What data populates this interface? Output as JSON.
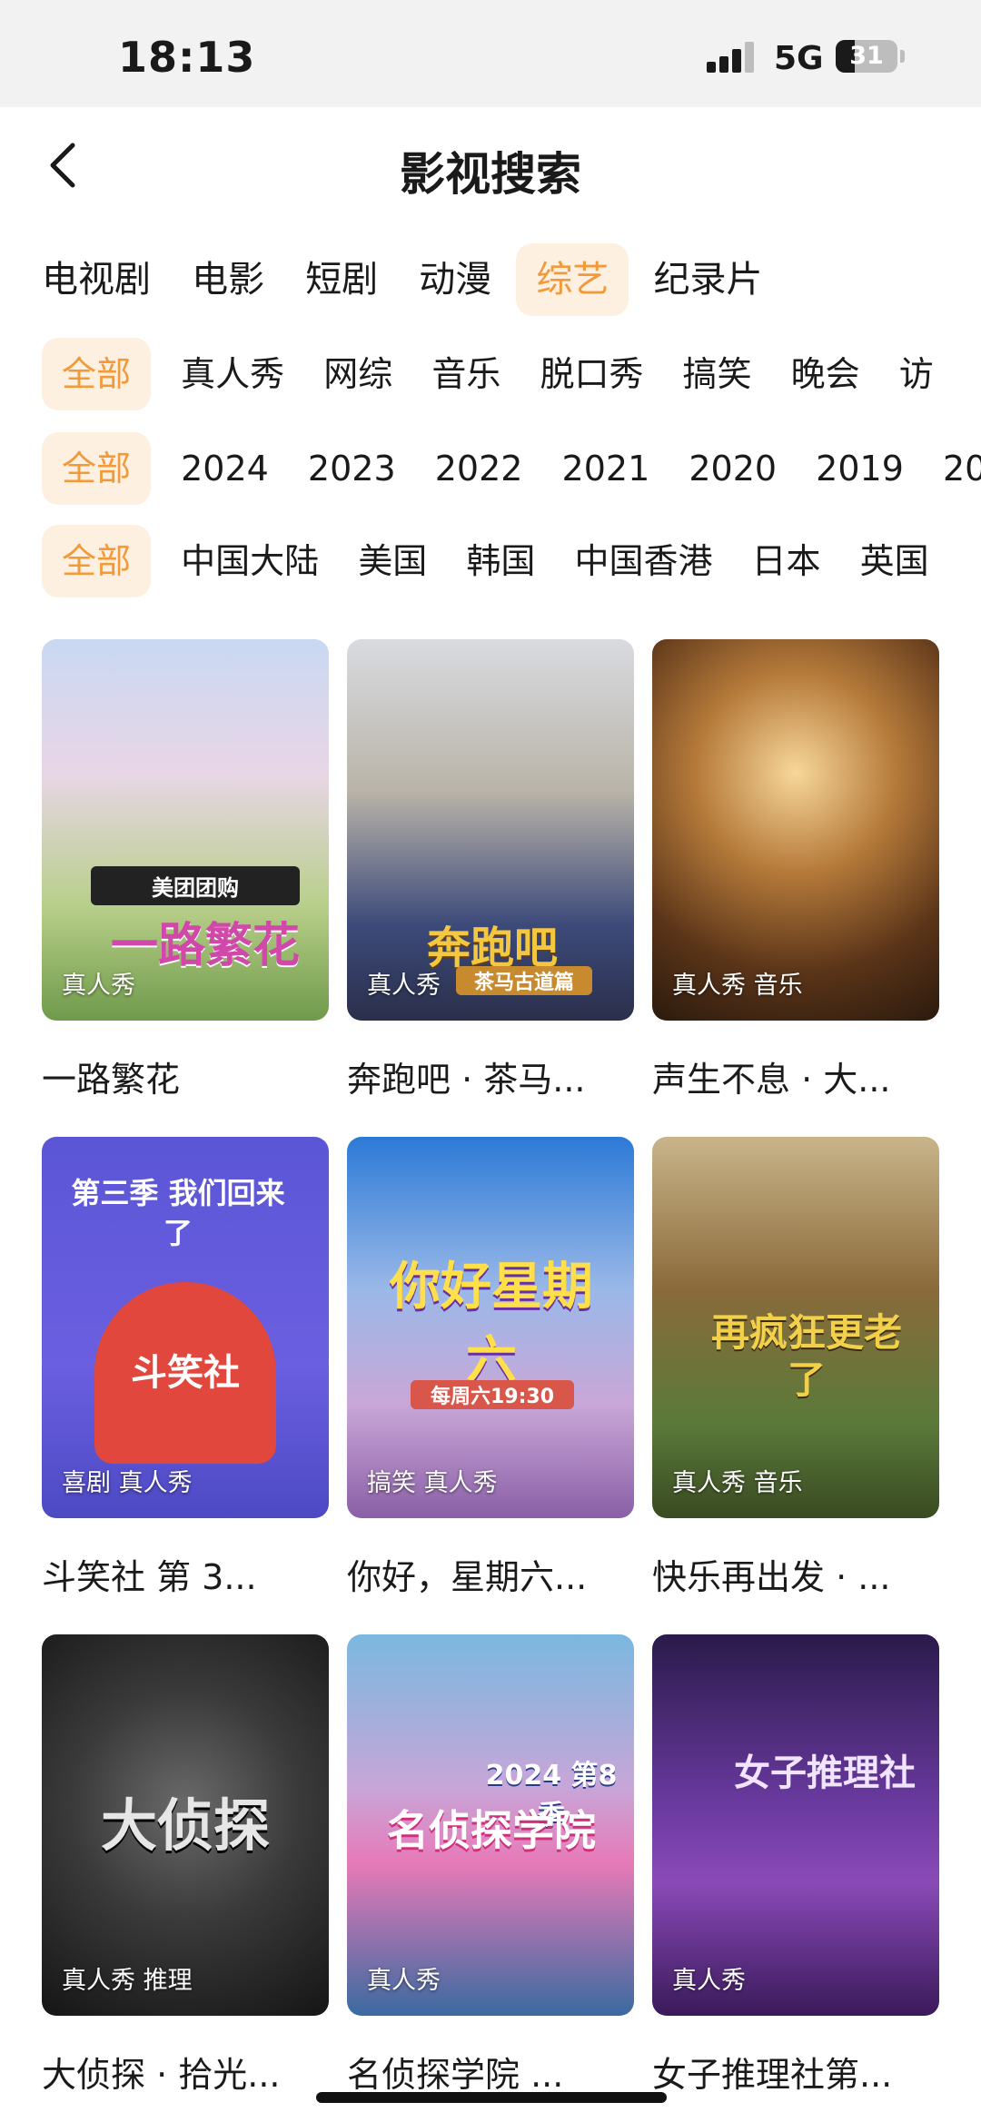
{
  "status_bar": {
    "time": "18:13",
    "network": "5G",
    "battery": "31"
  },
  "header": {
    "title": "影视搜索",
    "back_icon": "chevron-left-icon"
  },
  "filters": {
    "types": [
      "电视剧",
      "电影",
      "短剧",
      "动漫",
      "综艺",
      "纪录片"
    ],
    "type_active": "综艺",
    "genres": [
      "全部",
      "真人秀",
      "网综",
      "音乐",
      "脱口秀",
      "搞笑",
      "晚会",
      "访"
    ],
    "years": [
      "全部",
      "2024",
      "2023",
      "2022",
      "2021",
      "2020",
      "2019",
      "20"
    ],
    "regions": [
      "全部",
      "中国大陆",
      "美国",
      "韩国",
      "中国香港",
      "日本",
      "英国"
    ],
    "active_color": "#f29a3a"
  },
  "cards": [
    {
      "title": "一路繁花",
      "tags": "真人秀",
      "poster_text": "一路繁花",
      "poster_badge": "美团团购"
    },
    {
      "title": "奔跑吧 · 茶马...",
      "tags": "真人秀",
      "poster_text": "奔跑吧",
      "poster_badge": "茶马古道篇"
    },
    {
      "title": "声生不息 · 大...",
      "tags": "真人秀 音乐",
      "poster_text": "",
      "poster_badge": ""
    },
    {
      "title": "斗笑社 第 3...",
      "tags": "喜剧 真人秀",
      "poster_text": "斗笑社",
      "poster_badge": "第三季 我们回来了"
    },
    {
      "title": "你好，星期六...",
      "tags": "搞笑 真人秀",
      "poster_text": "你好星期六",
      "poster_badge": "每周六19:30"
    },
    {
      "title": "快乐再出发 · ...",
      "tags": "真人秀 音乐",
      "poster_text": "再疯狂更老了",
      "poster_badge": ""
    },
    {
      "title": "大侦探 · 拾光...",
      "tags": "真人秀 推理",
      "poster_text": "大侦探",
      "poster_badge": ""
    },
    {
      "title": "名侦探学院 ...",
      "tags": "真人秀",
      "poster_text": "名侦探学院",
      "poster_badge": "2024 第8季"
    },
    {
      "title": "女子推理社第...",
      "tags": "真人秀",
      "poster_text": "女子推理社",
      "poster_badge": ""
    }
  ]
}
